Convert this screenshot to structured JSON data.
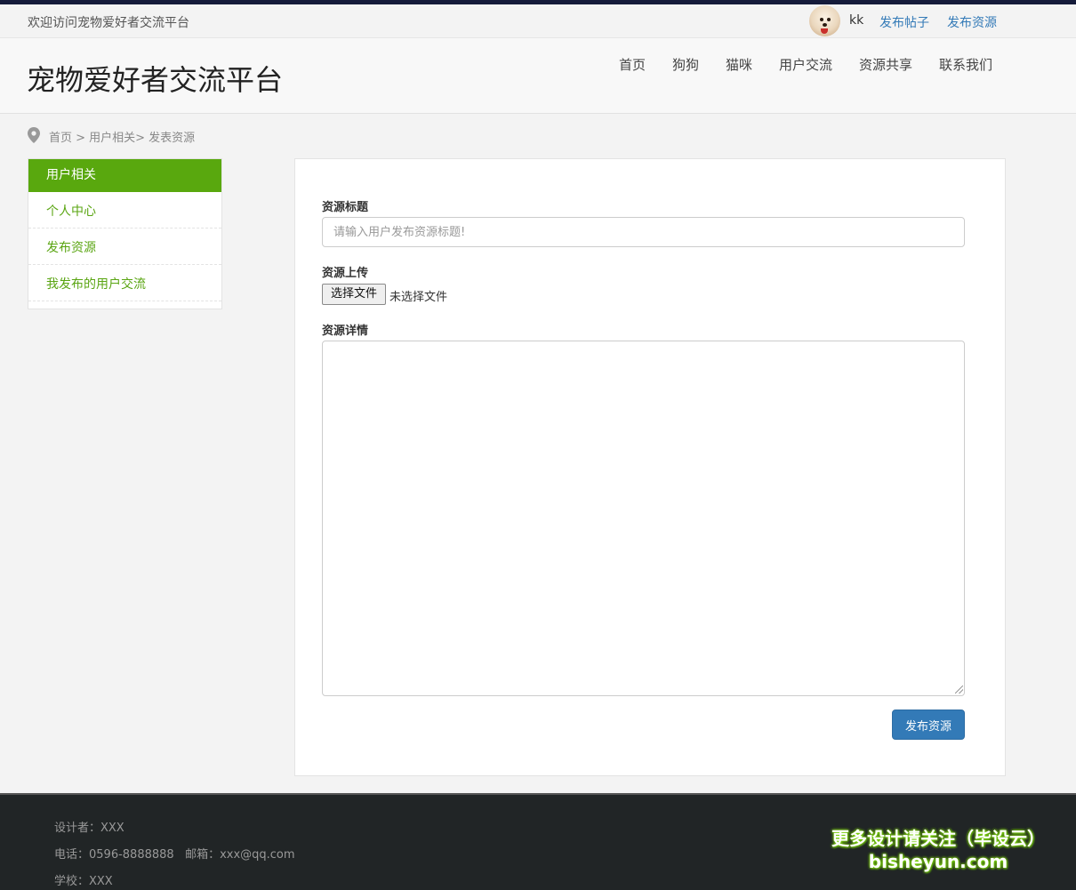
{
  "topbar": {
    "welcome": "欢迎访问宠物爱好者交流平台",
    "username": "kk",
    "links": [
      "发布帖子",
      "发布资源"
    ]
  },
  "header": {
    "site_title": "宠物爱好者交流平台",
    "nav": [
      "首页",
      "狗狗",
      "猫咪",
      "用户交流",
      "资源共享",
      "联系我们"
    ]
  },
  "breadcrumb": {
    "text": "首页 > 用户相关> 发表资源"
  },
  "sidebar": {
    "heading": "用户相关",
    "items": [
      "个人中心",
      "发布资源",
      "我发布的用户交流"
    ]
  },
  "form": {
    "title_label": "资源标题",
    "title_placeholder": "请输入用户发布资源标题!",
    "upload_label": "资源上传",
    "file_button": "选择文件",
    "file_status": "未选择文件",
    "detail_label": "资源详情",
    "submit": "发布资源"
  },
  "footer": {
    "designer": "设计者：XXX",
    "contact": "电话：0596-8888888   邮箱：xxx@qq.com",
    "school": "学校：XXX"
  },
  "watermark": {
    "line1": "更多设计请关注（毕设云）",
    "line2": "bisheyun.com"
  },
  "colors": {
    "accent_green": "#59a80e",
    "link_blue": "#337ab7",
    "footer_bg": "#212526"
  }
}
